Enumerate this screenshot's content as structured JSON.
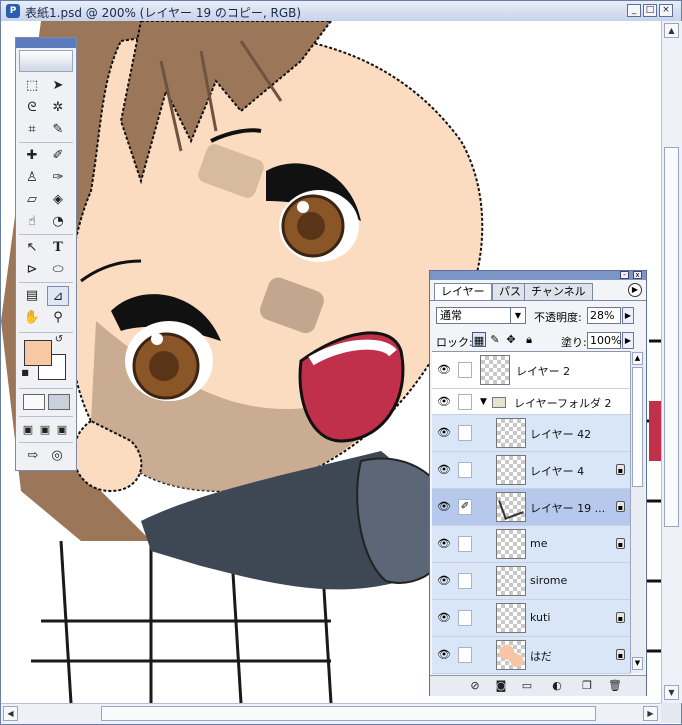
{
  "window": {
    "title": "表紙1.psd @ 200% (レイヤー 19 のコピー, RGB)",
    "app_icon": "photoshop-icon",
    "buttons": {
      "minimize": "_",
      "maximize": "□",
      "close": "×"
    }
  },
  "toolbox": {
    "colors": {
      "foreground": "#f6c8a4",
      "background": "#ffffff"
    },
    "icons": [
      "marquee-icon",
      "move-icon",
      "lasso-icon",
      "magic-wand-icon",
      "crop-icon",
      "slice-icon",
      "healing-icon",
      "brush-icon",
      "stamp-icon",
      "history-brush-icon",
      "eraser-icon",
      "bucket-icon",
      "smudge-icon",
      "dodge-icon",
      "path-select-icon",
      "type-icon",
      "pen-icon",
      "shape-icon",
      "notes-icon",
      "eyedropper-icon",
      "hand-icon",
      "zoom-icon"
    ],
    "type_tool_glyph": "T"
  },
  "layers_panel": {
    "tabs": [
      "レイヤー",
      "パス",
      "チャンネル"
    ],
    "blend_mode": "通常",
    "opacity_label": "不透明度:",
    "opacity_value": "28%",
    "lock_label": "ロック:",
    "fill_label": "塗り:",
    "fill_value": "100%",
    "layers": [
      {
        "name": "レイヤー 2",
        "type": "layer",
        "visible": true,
        "locked": false,
        "selected": false,
        "in_group": false
      },
      {
        "name": "レイヤーフォルダ 2",
        "type": "group",
        "visible": true,
        "locked": false,
        "selected": false,
        "in_group": false
      },
      {
        "name": "レイヤー 42",
        "type": "layer",
        "visible": true,
        "locked": false,
        "selected": false,
        "in_group": true
      },
      {
        "name": "レイヤー 4",
        "type": "layer",
        "visible": true,
        "locked": true,
        "selected": false,
        "in_group": true
      },
      {
        "name": "レイヤー 19 ...",
        "type": "layer",
        "visible": true,
        "locked": true,
        "selected": true,
        "in_group": true
      },
      {
        "name": "me",
        "type": "layer",
        "visible": true,
        "locked": true,
        "selected": false,
        "in_group": true
      },
      {
        "name": "sirome",
        "type": "layer",
        "visible": true,
        "locked": false,
        "selected": false,
        "in_group": true
      },
      {
        "name": "kuti",
        "type": "layer",
        "visible": true,
        "locked": true,
        "selected": false,
        "in_group": true
      },
      {
        "name": "はだ",
        "type": "layer",
        "visible": true,
        "locked": true,
        "selected": false,
        "in_group": true
      }
    ],
    "bottom_icons": [
      "layer-style-icon",
      "mask-icon",
      "new-folder-icon",
      "adjustment-icon",
      "new-layer-icon",
      "trash-icon"
    ]
  },
  "artwork": {
    "colors": {
      "skin": "#fbdcc0",
      "skin_shadow": "#bfa388",
      "hair": "#9b7658",
      "hair_dark": "#6e5340",
      "eye": "#8a5628",
      "mouth": "#c0304a",
      "collar": "#5b6676"
    }
  }
}
